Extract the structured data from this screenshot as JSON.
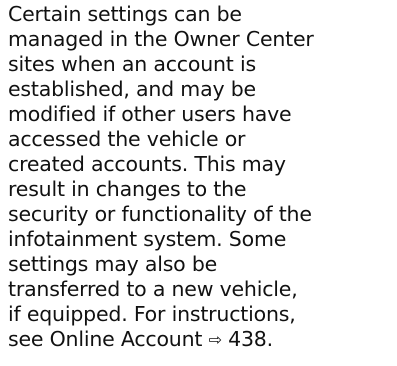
{
  "paragraph": {
    "lines": [
      "Certain settings can be",
      "managed in the Owner Center",
      "sites when an account is",
      "established, and may be",
      "modified if other users have",
      "accessed the vehicle or",
      "created accounts. This may",
      "result in changes to the",
      "security or functionality of the",
      "infotainment system. Some",
      "settings may also be",
      "transferred to a new vehicle,",
      "if equipped. For instructions,"
    ],
    "last_line_prefix": "see Online Account",
    "xref_arrow": "⇨",
    "xref_page": "438",
    "last_line_suffix": "."
  }
}
